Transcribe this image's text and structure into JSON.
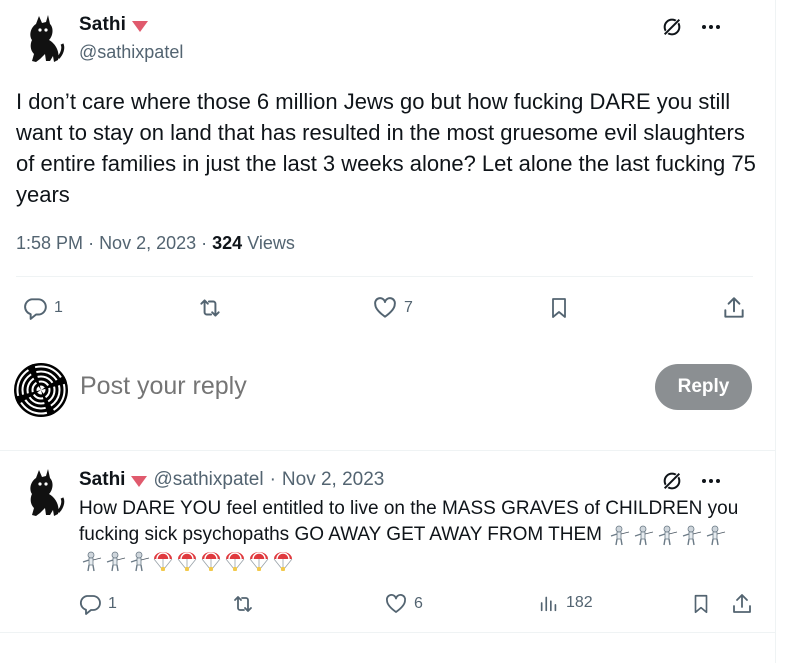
{
  "main_tweet": {
    "author_name": "Sathi",
    "author_handle": "@sathixpatel",
    "text": "I don’t care where those 6 million Jews go but how fucking DARE you still want to stay on land that has resulted in the most gruesome evil slaughters of entire families in just the last 3 weeks alone? Let alone the last fucking 75 years",
    "time": "1:58 PM",
    "date": "Nov 2, 2023",
    "views_count": "324",
    "views_label": "Views",
    "reply_count": "1",
    "like_count": "7"
  },
  "composer": {
    "placeholder": "Post your reply",
    "button_label": "Reply",
    "button_color": "#8b8f92"
  },
  "reply_tweet": {
    "author_name": "Sathi",
    "author_handle": "@sathixpatel",
    "date": "Nov 2, 2023",
    "text": "How DARE YOU feel entitled to live on the MASS GRAVES of CHILDREN you fucking sick psychopaths GO AWAY GET AWAY FROM THEM",
    "emoji_line_1": [
      "fencer",
      "fencer",
      "fencer",
      "fencer",
      "fencer"
    ],
    "emoji_line_2": [
      "fencer",
      "fencer",
      "fencer",
      "parachute",
      "parachute",
      "parachute",
      "parachute",
      "parachute",
      "parachute"
    ],
    "reply_count": "1",
    "like_count": "6",
    "views_count": "182"
  },
  "colors": {
    "text_primary": "#0f1419",
    "text_secondary": "#536471",
    "badge_red": "#e05a6d",
    "separator": "#eff3f4"
  },
  "icons": [
    "cat-avatar-icon",
    "verified-triangle-icon",
    "grok-icon",
    "more-icon",
    "reply-icon",
    "repost-icon",
    "like-icon",
    "bookmark-icon",
    "share-icon",
    "views-icon",
    "spiral-avatar-icon",
    "fencer-emoji",
    "parachute-emoji"
  ]
}
